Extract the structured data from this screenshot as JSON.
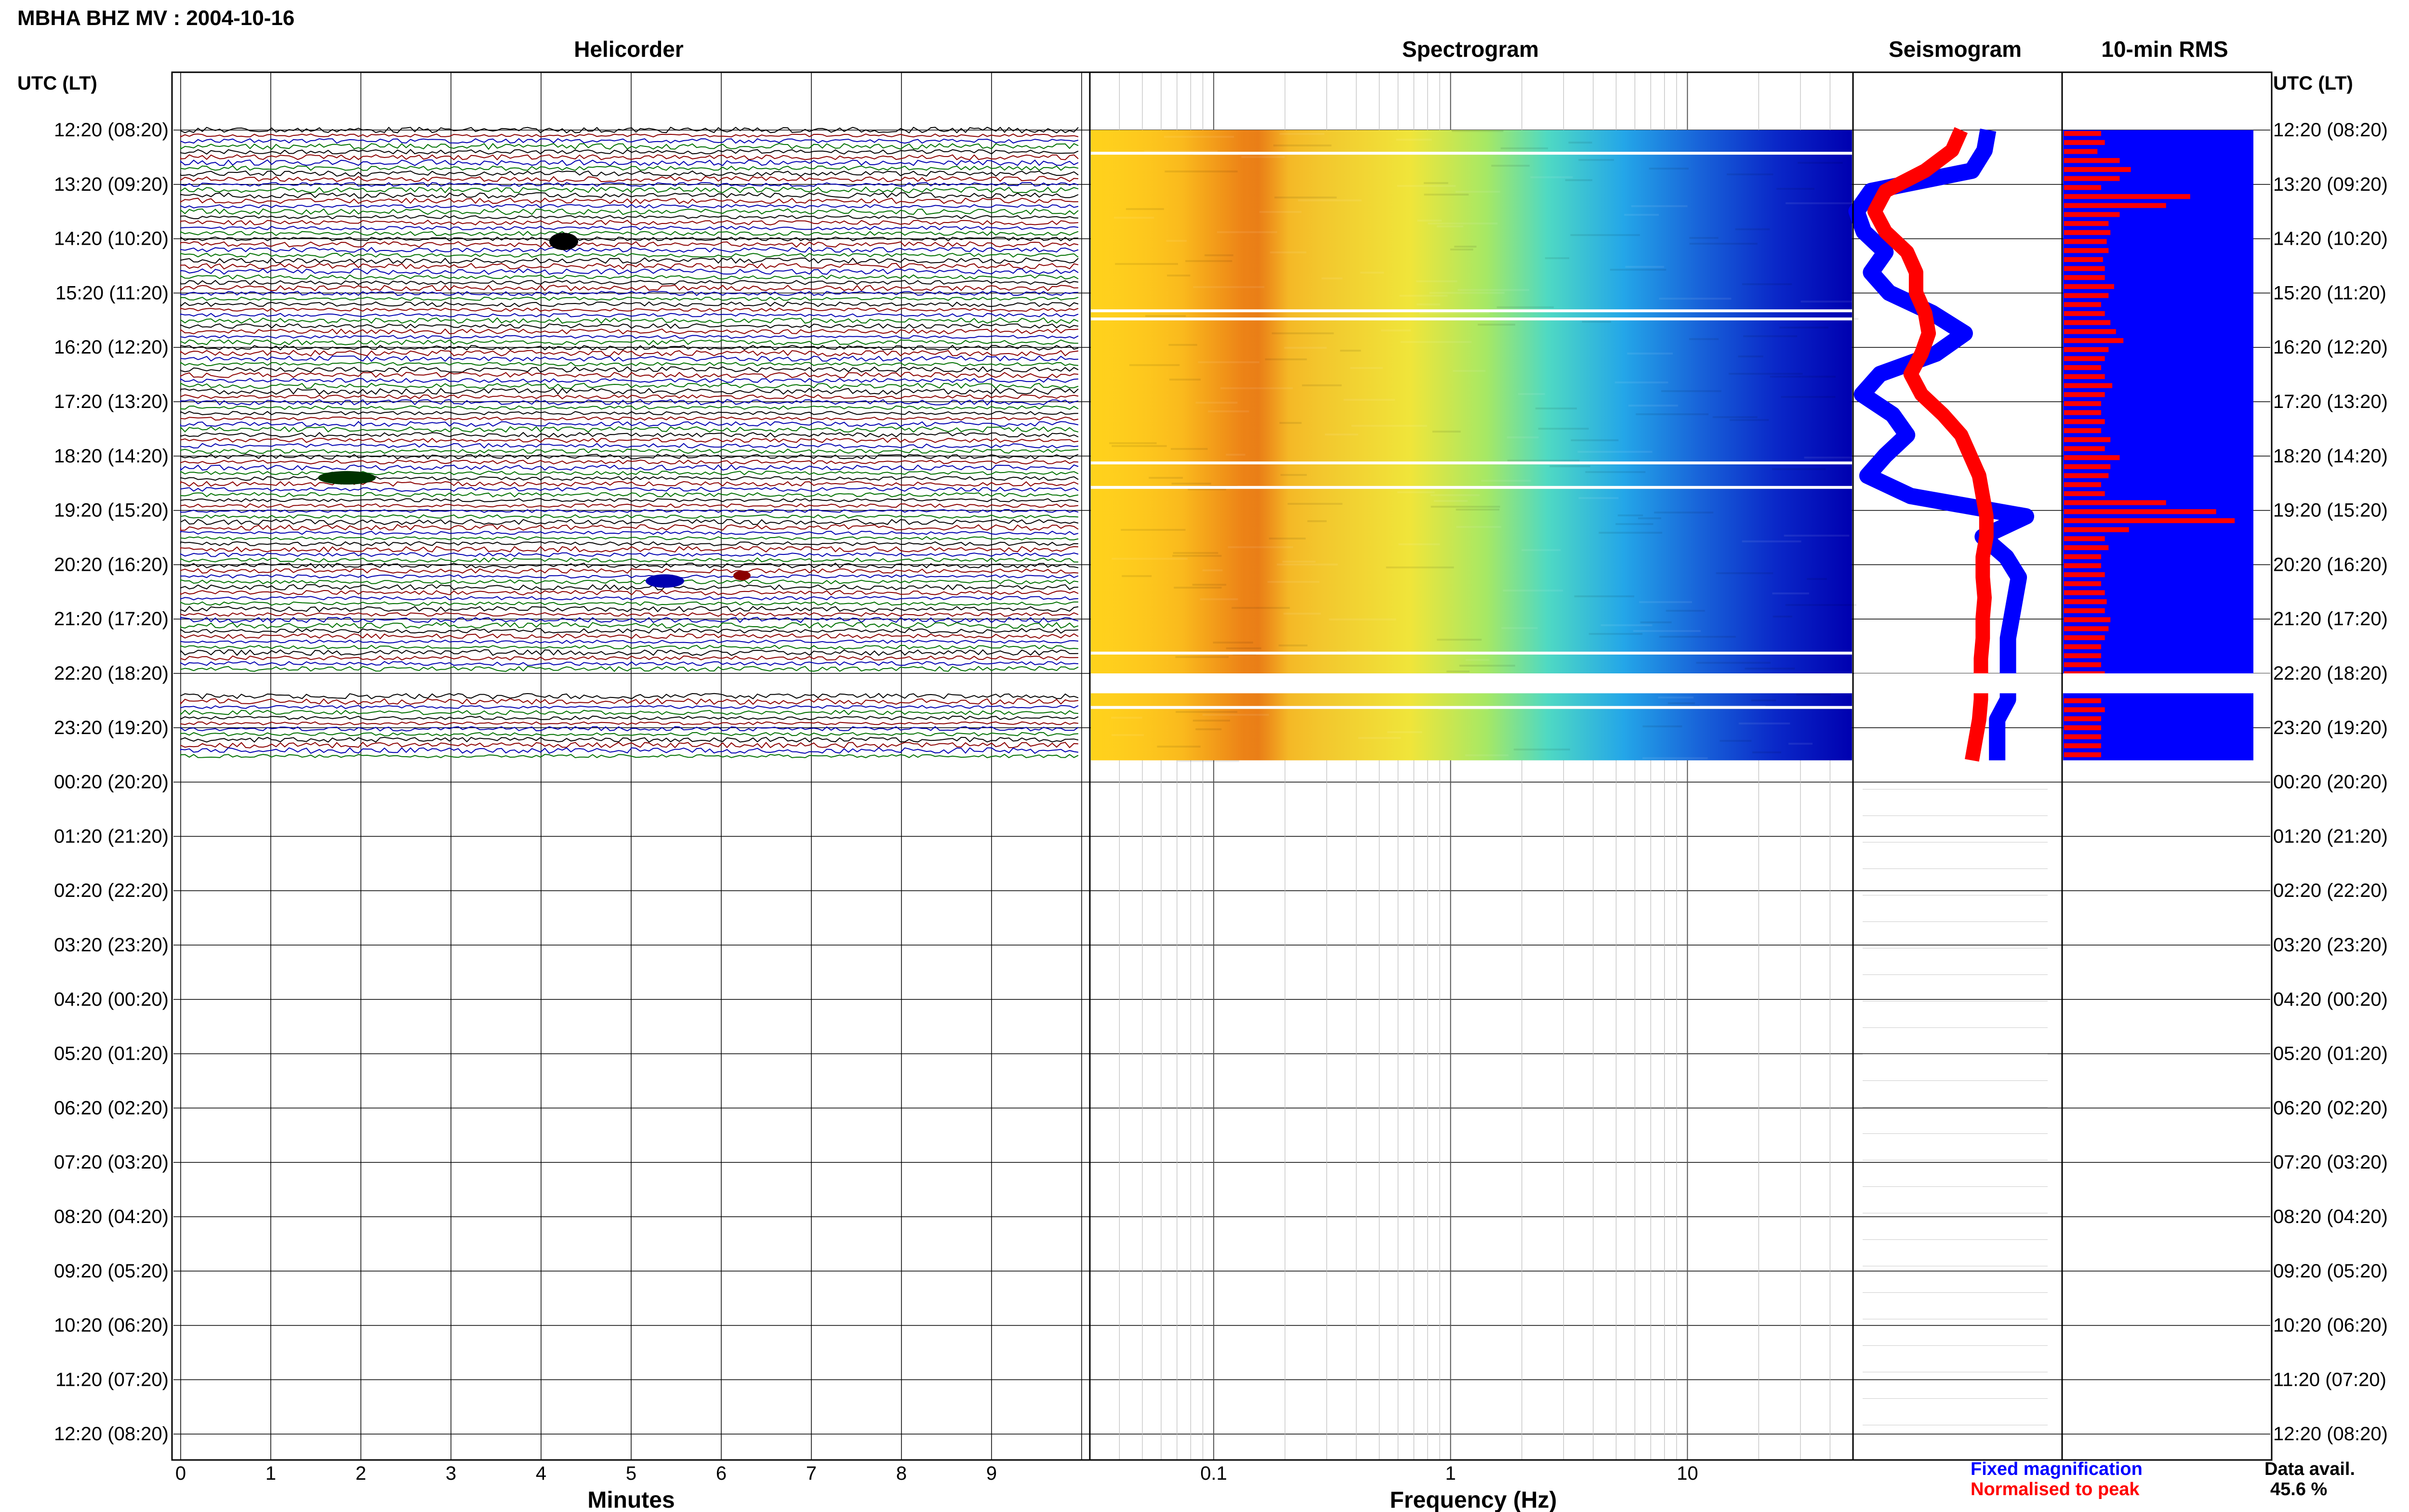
{
  "page_title": "MBHA BHZ MV : 2004-10-16",
  "axis_header_left": "UTC (LT)",
  "axis_header_right": "UTC (LT)",
  "panel_titles": {
    "helicorder": "Helicorder",
    "spectrogram": "Spectrogram",
    "seismogram": "Seismogram",
    "rms": "10-min RMS"
  },
  "row_labels": [
    "12:20 (08:20)",
    "13:20 (09:20)",
    "14:20 (10:20)",
    "15:20 (11:20)",
    "16:20 (12:20)",
    "17:20 (13:20)",
    "18:20 (14:20)",
    "19:20 (15:20)",
    "20:20 (16:20)",
    "21:20 (17:20)",
    "22:20 (18:20)",
    "23:20 (19:20)",
    "00:20 (20:20)",
    "01:20 (21:20)",
    "02:20 (22:20)",
    "03:20 (23:20)",
    "04:20 (00:20)",
    "05:20 (01:20)",
    "06:20 (02:20)",
    "07:20 (03:20)",
    "08:20 (04:20)",
    "09:20 (05:20)",
    "10:20 (06:20)",
    "11:20 (07:20)",
    "12:20 (08:20)"
  ],
  "helicorder_xlabel": "Minutes",
  "helicorder_ticks": [
    "0",
    "1",
    "2",
    "3",
    "4",
    "5",
    "6",
    "7",
    "8",
    "9"
  ],
  "spectrogram_xlabel": "Frequency (Hz)",
  "spectrogram_ticks": [
    "0.1",
    "1",
    "10"
  ],
  "legend": {
    "fixed": "Fixed magnification",
    "normalised": "Normalised to peak"
  },
  "data_avail": {
    "label": "Data avail.",
    "value": "45.6 %"
  },
  "colors": {
    "trace_black": "#000000",
    "trace_red": "#8b0000",
    "trace_green": "#007000",
    "trace_blue": "#0000b0",
    "fixed": "#0000ff",
    "normalised": "#ff0000"
  },
  "chart_data": {
    "type": "heatmap",
    "title": "MBHA BHZ MV : 2004-10-16",
    "hours_total": 24,
    "hours_with_data": 11.6,
    "gap_hours": [
      [
        10.0,
        10.1
      ]
    ],
    "helicorder": {
      "xlabel": "Minutes",
      "xlim": [
        0,
        10
      ],
      "ticks": [
        0,
        1,
        2,
        3,
        4,
        5,
        6,
        7,
        8,
        9
      ]
    },
    "spectrogram": {
      "xlabel": "Frequency (Hz)",
      "xscale": "log",
      "xlim": [
        0.03,
        50
      ],
      "ticks": [
        0.1,
        1,
        10
      ]
    },
    "seismogram_fixed_envelope": [
      0.75,
      0.73,
      0.66,
      0.1,
      0.02,
      0.06,
      0.18,
      0.1,
      0.2,
      0.44,
      0.62,
      0.46,
      0.15,
      0.05,
      0.22,
      0.3,
      0.18,
      0.08,
      0.32,
      0.96,
      0.72,
      0.85,
      0.92,
      0.9,
      0.88,
      0.86,
      0.86,
      0.86,
      0.86,
      0.8,
      0.8,
      0.8
    ],
    "seismogram_normalised_envelope": [
      0.6,
      0.55,
      0.4,
      0.18,
      0.12,
      0.18,
      0.3,
      0.35,
      0.35,
      0.4,
      0.42,
      0.38,
      0.32,
      0.38,
      0.5,
      0.6,
      0.65,
      0.7,
      0.72,
      0.74,
      0.74,
      0.72,
      0.72,
      0.73,
      0.72,
      0.72,
      0.71,
      0.71,
      0.71,
      0.7,
      0.68,
      0.66
    ],
    "rms_10min_normalised": [
      0.2,
      0.22,
      0.18,
      0.3,
      0.36,
      0.3,
      0.2,
      0.68,
      0.55,
      0.3,
      0.24,
      0.25,
      0.23,
      0.24,
      0.21,
      0.22,
      0.22,
      0.27,
      0.24,
      0.2,
      0.22,
      0.25,
      0.28,
      0.32,
      0.24,
      0.22,
      0.2,
      0.22,
      0.26,
      0.22,
      0.2,
      0.2,
      0.22,
      0.2,
      0.25,
      0.22,
      0.3,
      0.25,
      0.24,
      0.2,
      0.22,
      0.55,
      0.82,
      0.92,
      0.35,
      0.22,
      0.24,
      0.2,
      0.2,
      0.22,
      0.2,
      0.22,
      0.23,
      0.22,
      0.25,
      0.24,
      0.22,
      0.2,
      0.2,
      0.2,
      0.22,
      0.22,
      0.2,
      0.2,
      0.22,
      0.2,
      0.2,
      0.2,
      0.2,
      0.2
    ]
  }
}
